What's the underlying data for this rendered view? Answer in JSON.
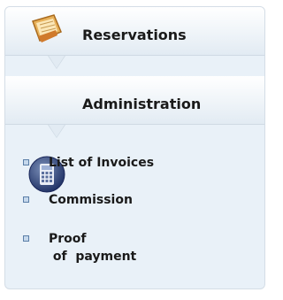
{
  "sections": [
    {
      "label": "Reservations",
      "icon": "book-icon"
    },
    {
      "label": "Administration",
      "icon": "calculator-icon"
    }
  ],
  "menu": {
    "items": [
      {
        "label": "List of Invoices"
      },
      {
        "label": "Commission"
      },
      {
        "label": "Proof\n of  payment"
      }
    ]
  },
  "colors": {
    "panel_bg": "#e9f1f8",
    "border": "#d4dde6",
    "bullet": "#5b7fa8",
    "text": "#1a1a1a"
  }
}
